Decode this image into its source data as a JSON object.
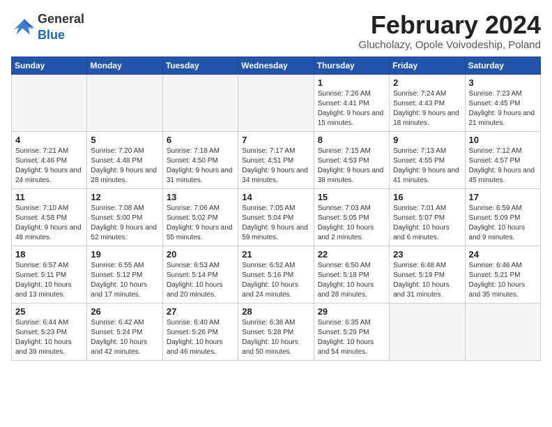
{
  "header": {
    "logo_general": "General",
    "logo_blue": "Blue",
    "month_year": "February 2024",
    "location": "Glucholazy, Opole Voivodeship, Poland"
  },
  "days_of_week": [
    "Sunday",
    "Monday",
    "Tuesday",
    "Wednesday",
    "Thursday",
    "Friday",
    "Saturday"
  ],
  "weeks": [
    [
      {
        "day": "",
        "empty": true
      },
      {
        "day": "",
        "empty": true
      },
      {
        "day": "",
        "empty": true
      },
      {
        "day": "",
        "empty": true
      },
      {
        "day": "1",
        "sunrise": "7:26 AM",
        "sunset": "4:41 PM",
        "daylight": "9 hours and 15 minutes."
      },
      {
        "day": "2",
        "sunrise": "7:24 AM",
        "sunset": "4:43 PM",
        "daylight": "9 hours and 18 minutes."
      },
      {
        "day": "3",
        "sunrise": "7:23 AM",
        "sunset": "4:45 PM",
        "daylight": "9 hours and 21 minutes."
      }
    ],
    [
      {
        "day": "4",
        "sunrise": "7:21 AM",
        "sunset": "4:46 PM",
        "daylight": "9 hours and 24 minutes."
      },
      {
        "day": "5",
        "sunrise": "7:20 AM",
        "sunset": "4:48 PM",
        "daylight": "9 hours and 28 minutes."
      },
      {
        "day": "6",
        "sunrise": "7:18 AM",
        "sunset": "4:50 PM",
        "daylight": "9 hours and 31 minutes."
      },
      {
        "day": "7",
        "sunrise": "7:17 AM",
        "sunset": "4:51 PM",
        "daylight": "9 hours and 34 minutes."
      },
      {
        "day": "8",
        "sunrise": "7:15 AM",
        "sunset": "4:53 PM",
        "daylight": "9 hours and 38 minutes."
      },
      {
        "day": "9",
        "sunrise": "7:13 AM",
        "sunset": "4:55 PM",
        "daylight": "9 hours and 41 minutes."
      },
      {
        "day": "10",
        "sunrise": "7:12 AM",
        "sunset": "4:57 PM",
        "daylight": "9 hours and 45 minutes."
      }
    ],
    [
      {
        "day": "11",
        "sunrise": "7:10 AM",
        "sunset": "4:58 PM",
        "daylight": "9 hours and 48 minutes."
      },
      {
        "day": "12",
        "sunrise": "7:08 AM",
        "sunset": "5:00 PM",
        "daylight": "9 hours and 52 minutes."
      },
      {
        "day": "13",
        "sunrise": "7:06 AM",
        "sunset": "5:02 PM",
        "daylight": "9 hours and 55 minutes."
      },
      {
        "day": "14",
        "sunrise": "7:05 AM",
        "sunset": "5:04 PM",
        "daylight": "9 hours and 59 minutes."
      },
      {
        "day": "15",
        "sunrise": "7:03 AM",
        "sunset": "5:05 PM",
        "daylight": "10 hours and 2 minutes."
      },
      {
        "day": "16",
        "sunrise": "7:01 AM",
        "sunset": "5:07 PM",
        "daylight": "10 hours and 6 minutes."
      },
      {
        "day": "17",
        "sunrise": "6:59 AM",
        "sunset": "5:09 PM",
        "daylight": "10 hours and 9 minutes."
      }
    ],
    [
      {
        "day": "18",
        "sunrise": "6:57 AM",
        "sunset": "5:11 PM",
        "daylight": "10 hours and 13 minutes."
      },
      {
        "day": "19",
        "sunrise": "6:55 AM",
        "sunset": "5:12 PM",
        "daylight": "10 hours and 17 minutes."
      },
      {
        "day": "20",
        "sunrise": "6:53 AM",
        "sunset": "5:14 PM",
        "daylight": "10 hours and 20 minutes."
      },
      {
        "day": "21",
        "sunrise": "6:52 AM",
        "sunset": "5:16 PM",
        "daylight": "10 hours and 24 minutes."
      },
      {
        "day": "22",
        "sunrise": "6:50 AM",
        "sunset": "5:18 PM",
        "daylight": "10 hours and 28 minutes."
      },
      {
        "day": "23",
        "sunrise": "6:48 AM",
        "sunset": "5:19 PM",
        "daylight": "10 hours and 31 minutes."
      },
      {
        "day": "24",
        "sunrise": "6:46 AM",
        "sunset": "5:21 PM",
        "daylight": "10 hours and 35 minutes."
      }
    ],
    [
      {
        "day": "25",
        "sunrise": "6:44 AM",
        "sunset": "5:23 PM",
        "daylight": "10 hours and 39 minutes."
      },
      {
        "day": "26",
        "sunrise": "6:42 AM",
        "sunset": "5:24 PM",
        "daylight": "10 hours and 42 minutes."
      },
      {
        "day": "27",
        "sunrise": "6:40 AM",
        "sunset": "5:26 PM",
        "daylight": "10 hours and 46 minutes."
      },
      {
        "day": "28",
        "sunrise": "6:38 AM",
        "sunset": "5:28 PM",
        "daylight": "10 hours and 50 minutes."
      },
      {
        "day": "29",
        "sunrise": "6:35 AM",
        "sunset": "5:29 PM",
        "daylight": "10 hours and 54 minutes."
      },
      {
        "day": "",
        "empty": true
      },
      {
        "day": "",
        "empty": true
      }
    ]
  ]
}
